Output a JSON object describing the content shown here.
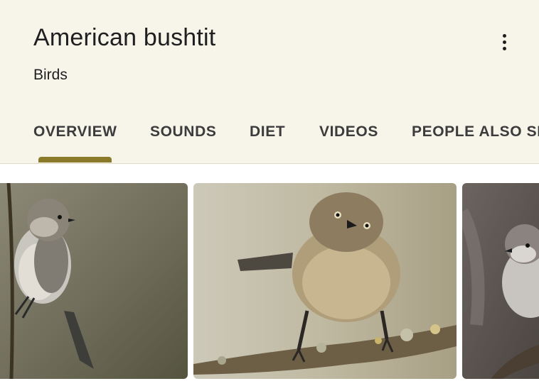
{
  "header": {
    "title": "American bushtit",
    "subtitle": "Birds",
    "more_icon": "more-vert-icon"
  },
  "tabs": [
    {
      "label": "OVERVIEW",
      "active": true
    },
    {
      "label": "SOUNDS",
      "active": false
    },
    {
      "label": "DIET",
      "active": false
    },
    {
      "label": "VIDEOS",
      "active": false
    },
    {
      "label": "PEOPLE ALSO SEARCH FOR",
      "active": false
    }
  ],
  "colors": {
    "header_bg": "#f7f4ea",
    "tab_indicator": "#8a7a2a",
    "tab_text": "#3c3c3c"
  },
  "images": [
    {
      "subject": "bushtit-perched-on-stem"
    },
    {
      "subject": "bushtit-on-lichen-branch"
    },
    {
      "subject": "bushtit-partial"
    }
  ]
}
